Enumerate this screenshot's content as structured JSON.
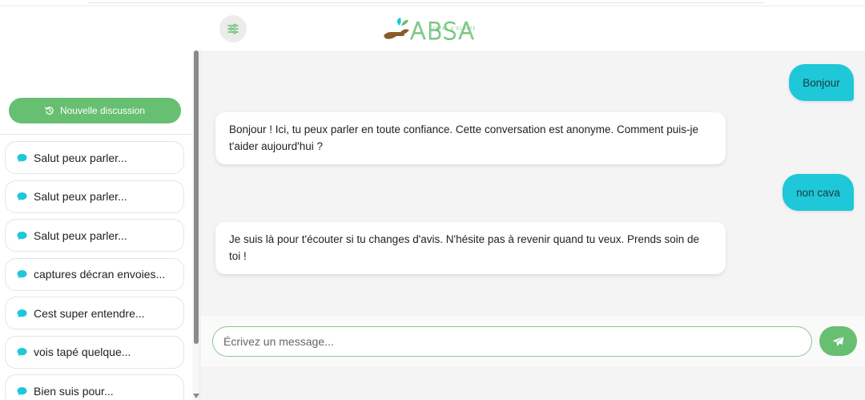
{
  "header": {
    "logo_text": "ABSA",
    "logo_tagline": "CENTRE D'ÉCOUTE",
    "settings_icon": "sliders-icon",
    "colors": {
      "logo_green": "#67bf72",
      "logo_hand": "#8b5a2b",
      "logo_leaf": "#1ec8d8"
    }
  },
  "sidebar": {
    "new_chat_label": "Nouvelle discussion",
    "new_chat_icon": "history-icon",
    "conversations": [
      {
        "label": "Salut peux parler..."
      },
      {
        "label": "Salut peux parler..."
      },
      {
        "label": "Salut peux parler..."
      },
      {
        "label": "captures décran envoies..."
      },
      {
        "label": "Cest super entendre..."
      },
      {
        "label": "vois tapé quelque..."
      },
      {
        "label": "Bien suis pour..."
      }
    ],
    "conversation_icon": "chat-bubble-icon"
  },
  "chat": {
    "messages": [
      {
        "role": "user",
        "text": "Bonjour"
      },
      {
        "role": "bot",
        "text": "Bonjour ! Ici, tu peux parler en toute confiance. Cette conversation est anonyme. Comment puis-je t'aider aujourd'hui ?"
      },
      {
        "role": "user",
        "text": "non cava"
      },
      {
        "role": "bot",
        "text": "Je suis là pour t'écouter si tu changes d'avis. N'hésite pas à revenir quand tu veux. Prends soin de toi !"
      }
    ]
  },
  "composer": {
    "placeholder": "Écrivez un message...",
    "value": "",
    "send_icon": "paper-plane-icon"
  },
  "colors": {
    "accent_green": "#67bf72",
    "user_bubble": "#1ec8d8",
    "background": "#f4f4f4"
  }
}
